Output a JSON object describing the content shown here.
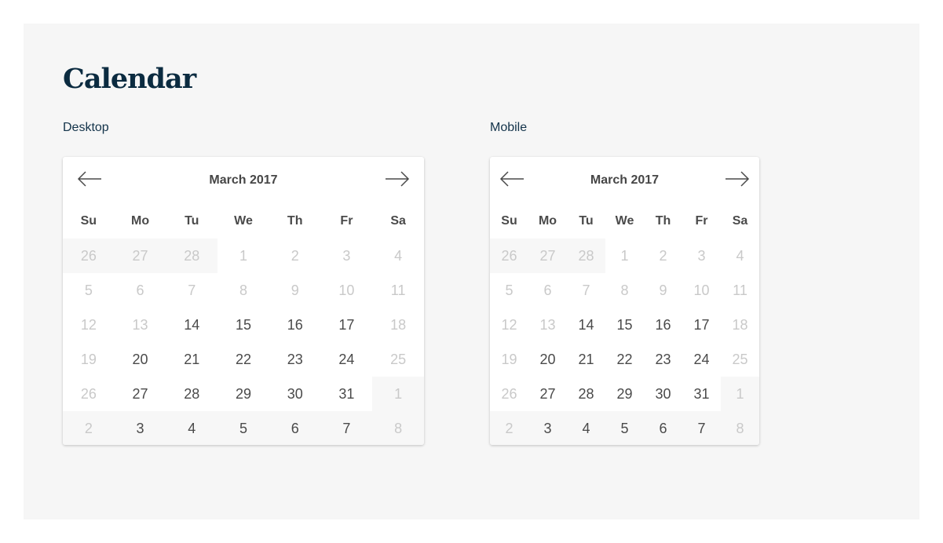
{
  "page": {
    "title": "Calendar"
  },
  "desktop": {
    "label": "Desktop",
    "month": "March 2017",
    "prev_icon": "arrow-left-icon",
    "next_icon": "arrow-right-icon",
    "weekdays": [
      "Su",
      "Mo",
      "Tu",
      "We",
      "Th",
      "Fr",
      "Sa"
    ],
    "days": [
      {
        "d": "26",
        "active": false,
        "shaded": true
      },
      {
        "d": "27",
        "active": false,
        "shaded": true
      },
      {
        "d": "28",
        "active": false,
        "shaded": true
      },
      {
        "d": "1",
        "active": false,
        "shaded": false
      },
      {
        "d": "2",
        "active": false,
        "shaded": false
      },
      {
        "d": "3",
        "active": false,
        "shaded": false
      },
      {
        "d": "4",
        "active": false,
        "shaded": false
      },
      {
        "d": "5",
        "active": false,
        "shaded": false
      },
      {
        "d": "6",
        "active": false,
        "shaded": false
      },
      {
        "d": "7",
        "active": false,
        "shaded": false
      },
      {
        "d": "8",
        "active": false,
        "shaded": false
      },
      {
        "d": "9",
        "active": false,
        "shaded": false
      },
      {
        "d": "10",
        "active": false,
        "shaded": false
      },
      {
        "d": "11",
        "active": false,
        "shaded": false
      },
      {
        "d": "12",
        "active": false,
        "shaded": false
      },
      {
        "d": "13",
        "active": false,
        "shaded": false
      },
      {
        "d": "14",
        "active": true,
        "shaded": false
      },
      {
        "d": "15",
        "active": true,
        "shaded": false
      },
      {
        "d": "16",
        "active": true,
        "shaded": false
      },
      {
        "d": "17",
        "active": true,
        "shaded": false
      },
      {
        "d": "18",
        "active": false,
        "shaded": false
      },
      {
        "d": "19",
        "active": false,
        "shaded": false
      },
      {
        "d": "20",
        "active": true,
        "shaded": false
      },
      {
        "d": "21",
        "active": true,
        "shaded": false
      },
      {
        "d": "22",
        "active": true,
        "shaded": false
      },
      {
        "d": "23",
        "active": true,
        "shaded": false
      },
      {
        "d": "24",
        "active": true,
        "shaded": false
      },
      {
        "d": "25",
        "active": false,
        "shaded": false
      },
      {
        "d": "26",
        "active": false,
        "shaded": false
      },
      {
        "d": "27",
        "active": true,
        "shaded": false
      },
      {
        "d": "28",
        "active": true,
        "shaded": false
      },
      {
        "d": "29",
        "active": true,
        "shaded": false
      },
      {
        "d": "30",
        "active": true,
        "shaded": false
      },
      {
        "d": "31",
        "active": true,
        "shaded": false
      },
      {
        "d": "1",
        "active": false,
        "shaded": true
      },
      {
        "d": "2",
        "active": false,
        "shaded": true
      },
      {
        "d": "3",
        "active": true,
        "shaded": true
      },
      {
        "d": "4",
        "active": true,
        "shaded": true
      },
      {
        "d": "5",
        "active": true,
        "shaded": true
      },
      {
        "d": "6",
        "active": true,
        "shaded": true
      },
      {
        "d": "7",
        "active": true,
        "shaded": true
      },
      {
        "d": "8",
        "active": false,
        "shaded": true
      }
    ]
  },
  "mobile": {
    "label": "Mobile",
    "month": "March 2017",
    "prev_icon": "arrow-left-icon",
    "next_icon": "arrow-right-icon",
    "weekdays": [
      "Su",
      "Mo",
      "Tu",
      "We",
      "Th",
      "Fr",
      "Sa"
    ],
    "days": [
      {
        "d": "26",
        "active": false,
        "shaded": true
      },
      {
        "d": "27",
        "active": false,
        "shaded": true
      },
      {
        "d": "28",
        "active": false,
        "shaded": true
      },
      {
        "d": "1",
        "active": false,
        "shaded": false
      },
      {
        "d": "2",
        "active": false,
        "shaded": false
      },
      {
        "d": "3",
        "active": false,
        "shaded": false
      },
      {
        "d": "4",
        "active": false,
        "shaded": false
      },
      {
        "d": "5",
        "active": false,
        "shaded": false
      },
      {
        "d": "6",
        "active": false,
        "shaded": false
      },
      {
        "d": "7",
        "active": false,
        "shaded": false
      },
      {
        "d": "8",
        "active": false,
        "shaded": false
      },
      {
        "d": "9",
        "active": false,
        "shaded": false
      },
      {
        "d": "10",
        "active": false,
        "shaded": false
      },
      {
        "d": "11",
        "active": false,
        "shaded": false
      },
      {
        "d": "12",
        "active": false,
        "shaded": false
      },
      {
        "d": "13",
        "active": false,
        "shaded": false
      },
      {
        "d": "14",
        "active": true,
        "shaded": false
      },
      {
        "d": "15",
        "active": true,
        "shaded": false
      },
      {
        "d": "16",
        "active": true,
        "shaded": false
      },
      {
        "d": "17",
        "active": true,
        "shaded": false
      },
      {
        "d": "18",
        "active": false,
        "shaded": false
      },
      {
        "d": "19",
        "active": false,
        "shaded": false
      },
      {
        "d": "20",
        "active": true,
        "shaded": false
      },
      {
        "d": "21",
        "active": true,
        "shaded": false
      },
      {
        "d": "22",
        "active": true,
        "shaded": false
      },
      {
        "d": "23",
        "active": true,
        "shaded": false
      },
      {
        "d": "24",
        "active": true,
        "shaded": false
      },
      {
        "d": "25",
        "active": false,
        "shaded": false
      },
      {
        "d": "26",
        "active": false,
        "shaded": false
      },
      {
        "d": "27",
        "active": true,
        "shaded": false
      },
      {
        "d": "28",
        "active": true,
        "shaded": false
      },
      {
        "d": "29",
        "active": true,
        "shaded": false
      },
      {
        "d": "30",
        "active": true,
        "shaded": false
      },
      {
        "d": "31",
        "active": true,
        "shaded": false
      },
      {
        "d": "1",
        "active": false,
        "shaded": true
      },
      {
        "d": "2",
        "active": false,
        "shaded": true
      },
      {
        "d": "3",
        "active": true,
        "shaded": true
      },
      {
        "d": "4",
        "active": true,
        "shaded": true
      },
      {
        "d": "5",
        "active": true,
        "shaded": true
      },
      {
        "d": "6",
        "active": true,
        "shaded": true
      },
      {
        "d": "7",
        "active": true,
        "shaded": true
      },
      {
        "d": "8",
        "active": false,
        "shaded": true
      }
    ]
  },
  "colors": {
    "title": "#0b2b40",
    "active_day": "#4a4a4a",
    "inactive_day": "#c9c9c9",
    "shade": "#f7f7f7",
    "background": "#f6f6f6"
  }
}
